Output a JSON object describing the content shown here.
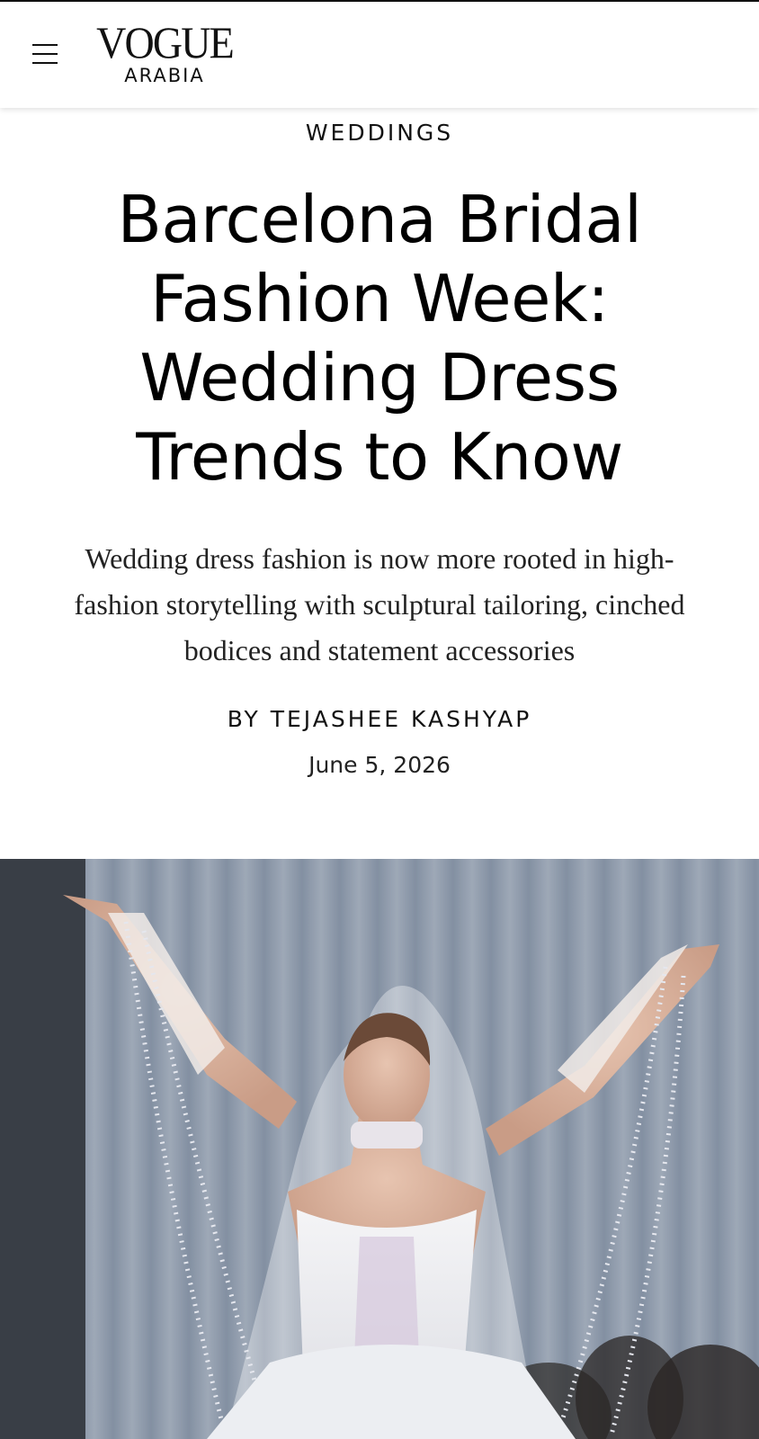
{
  "header": {
    "menu_icon": "hamburger-menu-icon",
    "logo_main": "VOGUE",
    "logo_sub": "ARABIA"
  },
  "article": {
    "category": "WEDDINGS",
    "headline": "Barcelona Bridal Fashion Week: Wedding Dress Trends to Know",
    "dek": "Wedding dress fashion is now more rooted in high-fashion storytelling with sculptural tailoring, cinched bodices and statement accessories",
    "byline_prefix": "BY",
    "author": "TEJASHEE KASHYAP",
    "date": "June 5, 2026"
  },
  "hero_image": {
    "subject": "bride-on-runway-photo"
  },
  "colors": {
    "text": "#111111",
    "background": "#ffffff",
    "hero_backdrop": "#8e9bad"
  }
}
